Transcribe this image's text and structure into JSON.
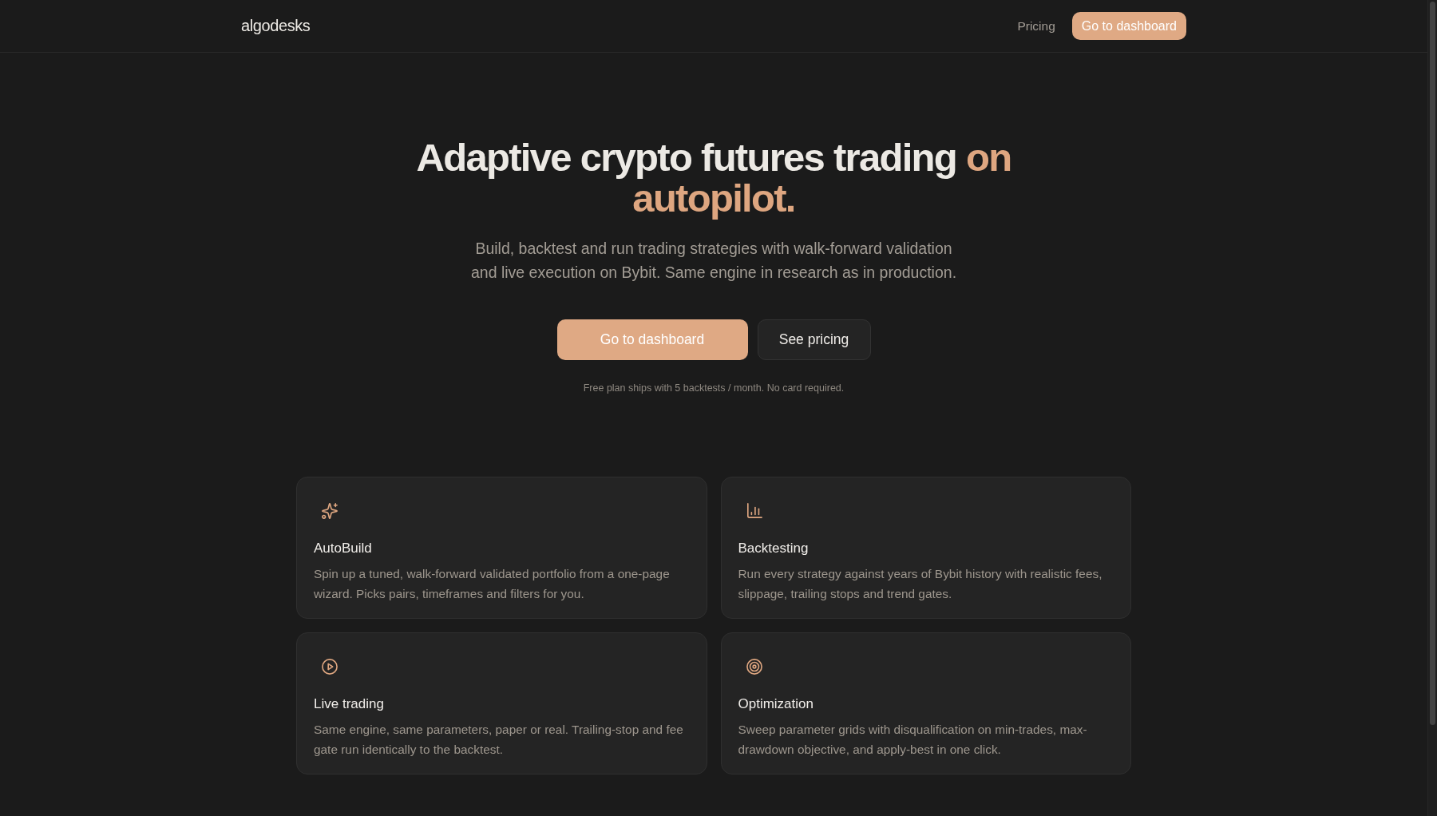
{
  "header": {
    "logo": "algodesks",
    "nav_links": [
      "Pricing"
    ],
    "cta_button": "Go to dashboard"
  },
  "hero": {
    "title": {
      "text": "Adaptive crypto futures trading",
      "accent": "on autopilot."
    },
    "subtitle": "Build, backtest and run trading strategies with walk-forward validation and live execution on Bybit. Same engine in research as in production.",
    "buttons": [
      {
        "label": "Go to dashboard",
        "kind": "primary"
      },
      {
        "label": "See pricing",
        "kind": "secondary"
      }
    ],
    "note": "Free plan ships with 5 backtests / month. No card required."
  },
  "features": [
    {
      "title": "AutoBuild",
      "description": "Spin up a tuned, walk-forward validated portfolio from a one-page wizard. Picks pairs, timeframes and filters for you."
    },
    {
      "title": "Backtesting",
      "description": "Run every strategy against years of Bybit history with realistic fees, slippage, trailing stops and trend gates."
    },
    {
      "title": "Live trading",
      "description": "Same engine, same parameters, paper or real. Trailing-stop and fee gate run identically to the backtest."
    },
    {
      "title": "Optimization",
      "description": "Sweep parameter grids with disqualification on min-trades, max-drawdown objective, and apply-best in one click."
    }
  ]
}
